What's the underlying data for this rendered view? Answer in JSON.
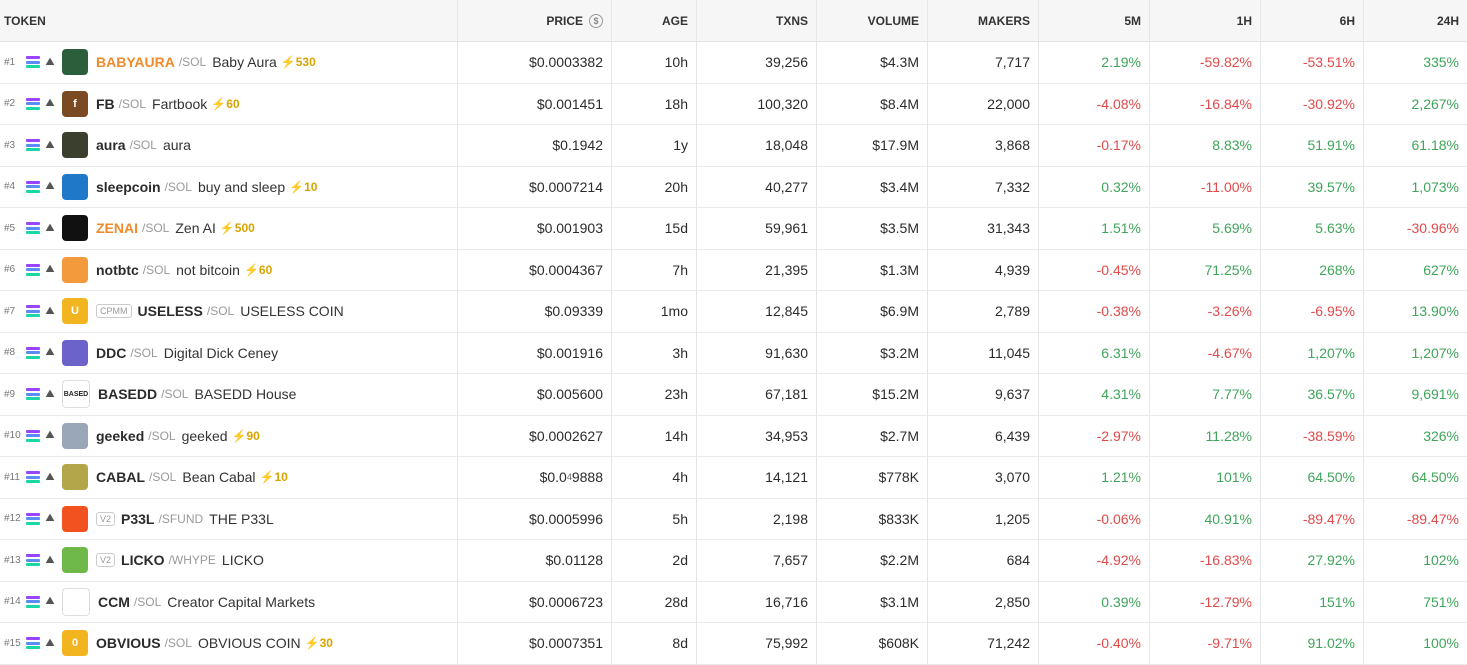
{
  "columns": {
    "token": "TOKEN",
    "price": "PRICE",
    "age": "AGE",
    "txns": "TXNS",
    "volume": "VOLUME",
    "makers": "MAKERS",
    "p5m": "5M",
    "p1h": "1H",
    "p6h": "6H",
    "p24h": "24H"
  },
  "colors": {
    "positive": "#3fa55a",
    "negative": "#e24a4a",
    "boost": "#d9a400",
    "highlight": "#f08b2c"
  },
  "rows": [
    {
      "rank": "#1",
      "symbol": "BABYAURA",
      "pair": "/SOL",
      "name": "Baby Aura",
      "boost": "⚡530",
      "tag": "",
      "highlight": true,
      "avatar": {
        "bg": "#2b5f3c",
        "glyph": ""
      },
      "price": "$0.0003382",
      "age": "10h",
      "txns": "39,256",
      "volume": "$4.3M",
      "makers": "7,717",
      "p5m": "2.19%",
      "p1h": "-59.82%",
      "p6h": "-53.51%",
      "p24h": "335%"
    },
    {
      "rank": "#2",
      "symbol": "FB",
      "pair": "/SOL",
      "name": "Fartbook",
      "boost": "⚡60",
      "tag": "",
      "highlight": false,
      "avatar": {
        "bg": "#7a4a22",
        "glyph": "f"
      },
      "price": "$0.001451",
      "age": "18h",
      "txns": "100,320",
      "volume": "$8.4M",
      "makers": "22,000",
      "p5m": "-4.08%",
      "p1h": "-16.84%",
      "p6h": "-30.92%",
      "p24h": "2,267%"
    },
    {
      "rank": "#3",
      "symbol": "aura",
      "pair": "/SOL",
      "name": "aura",
      "boost": "",
      "tag": "",
      "highlight": false,
      "avatar": {
        "bg": "#3a3f2e",
        "glyph": ""
      },
      "price": "$0.1942",
      "age": "1y",
      "txns": "18,048",
      "volume": "$17.9M",
      "makers": "3,868",
      "p5m": "-0.17%",
      "p1h": "8.83%",
      "p6h": "51.91%",
      "p24h": "61.18%"
    },
    {
      "rank": "#4",
      "symbol": "sleepcoin",
      "pair": "/SOL",
      "name": "buy and sleep",
      "boost": "⚡10",
      "tag": "",
      "highlight": false,
      "avatar": {
        "bg": "#1f79c8",
        "glyph": ""
      },
      "price": "$0.0007214",
      "age": "20h",
      "txns": "40,277",
      "volume": "$3.4M",
      "makers": "7,332",
      "p5m": "0.32%",
      "p1h": "-11.00%",
      "p6h": "39.57%",
      "p24h": "1,073%"
    },
    {
      "rank": "#5",
      "symbol": "ZENAI",
      "pair": "/SOL",
      "name": "Zen AI",
      "boost": "⚡500",
      "tag": "",
      "highlight": true,
      "avatar": {
        "bg": "#111111",
        "glyph": ""
      },
      "price": "$0.001903",
      "age": "15d",
      "txns": "59,961",
      "volume": "$3.5M",
      "makers": "31,343",
      "p5m": "1.51%",
      "p1h": "5.69%",
      "p6h": "5.63%",
      "p24h": "-30.96%"
    },
    {
      "rank": "#6",
      "symbol": "notbtc",
      "pair": "/SOL",
      "name": "not bitcoin",
      "boost": "⚡60",
      "tag": "",
      "highlight": false,
      "avatar": {
        "bg": "#f39a3c",
        "glyph": ""
      },
      "price": "$0.0004367",
      "age": "7h",
      "txns": "21,395",
      "volume": "$1.3M",
      "makers": "4,939",
      "p5m": "-0.45%",
      "p1h": "71.25%",
      "p6h": "268%",
      "p24h": "627%"
    },
    {
      "rank": "#7",
      "symbol": "USELESS",
      "pair": "/SOL",
      "name": "USELESS COIN",
      "boost": "",
      "tag": "CPMM",
      "highlight": false,
      "avatar": {
        "bg": "#f2b51f",
        "glyph": "U"
      },
      "price": "$0.09339",
      "age": "1mo",
      "txns": "12,845",
      "volume": "$6.9M",
      "makers": "2,789",
      "p5m": "-0.38%",
      "p1h": "-3.26%",
      "p6h": "-6.95%",
      "p24h": "13.90%"
    },
    {
      "rank": "#8",
      "symbol": "DDC",
      "pair": "/SOL",
      "name": "Digital Dick Ceney",
      "boost": "",
      "tag": "",
      "highlight": false,
      "avatar": {
        "bg": "#6b63c9",
        "glyph": ""
      },
      "price": "$0.001916",
      "age": "3h",
      "txns": "91,630",
      "volume": "$3.2M",
      "makers": "11,045",
      "p5m": "6.31%",
      "p1h": "-4.67%",
      "p6h": "1,207%",
      "p24h": "1,207%"
    },
    {
      "rank": "#9",
      "symbol": "BASEDD",
      "pair": "/SOL",
      "name": "BASEDD House",
      "boost": "",
      "tag": "",
      "highlight": false,
      "avatar": {
        "bg": "#ffffff",
        "glyph": "BASED"
      },
      "price": "$0.005600",
      "age": "23h",
      "txns": "67,181",
      "volume": "$15.2M",
      "makers": "9,637",
      "p5m": "4.31%",
      "p1h": "7.77%",
      "p6h": "36.57%",
      "p24h": "9,691%"
    },
    {
      "rank": "#10",
      "symbol": "geeked",
      "pair": "/SOL",
      "name": "geeked",
      "boost": "⚡90",
      "tag": "",
      "highlight": false,
      "avatar": {
        "bg": "#9aa7b8",
        "glyph": ""
      },
      "price": "$0.0002627",
      "age": "14h",
      "txns": "34,953",
      "volume": "$2.7M",
      "makers": "6,439",
      "p5m": "-2.97%",
      "p1h": "11.28%",
      "p6h": "-38.59%",
      "p24h": "326%"
    },
    {
      "rank": "#11",
      "symbol": "CABAL",
      "pair": "/SOL",
      "name": "Bean Cabal",
      "boost": "⚡10",
      "tag": "",
      "highlight": false,
      "avatar": {
        "bg": "#b3a64a",
        "glyph": ""
      },
      "price": "$0.0",
      "price_sub": "4",
      "price_tail": "9888",
      "age": "4h",
      "txns": "14,121",
      "volume": "$778K",
      "makers": "3,070",
      "p5m": "1.21%",
      "p1h": "101%",
      "p6h": "64.50%",
      "p24h": "64.50%"
    },
    {
      "rank": "#12",
      "symbol": "P33L",
      "pair": "/SFUND",
      "name": "THE P33L",
      "boost": "",
      "tag": "V2",
      "highlight": false,
      "avatar": {
        "bg": "#f2521f",
        "glyph": ""
      },
      "price": "$0.0005996",
      "age": "5h",
      "txns": "2,198",
      "volume": "$833K",
      "makers": "1,205",
      "p5m": "-0.06%",
      "p1h": "40.91%",
      "p6h": "-89.47%",
      "p24h": "-89.47%"
    },
    {
      "rank": "#13",
      "symbol": "LICKO",
      "pair": "/WHYPE",
      "name": "LICKO",
      "boost": "",
      "tag": "V2",
      "highlight": false,
      "avatar": {
        "bg": "#6fb84a",
        "glyph": ""
      },
      "price": "$0.01128",
      "age": "2d",
      "txns": "7,657",
      "volume": "$2.2M",
      "makers": "684",
      "p5m": "-4.92%",
      "p1h": "-16.83%",
      "p6h": "27.92%",
      "p24h": "102%"
    },
    {
      "rank": "#14",
      "symbol": "CCM",
      "pair": "/SOL",
      "name": "Creator Capital Markets",
      "boost": "",
      "tag": "",
      "highlight": false,
      "avatar": {
        "bg": "#ffffff",
        "glyph": ""
      },
      "price": "$0.0006723",
      "age": "28d",
      "txns": "16,716",
      "volume": "$3.1M",
      "makers": "2,850",
      "p5m": "0.39%",
      "p1h": "-12.79%",
      "p6h": "151%",
      "p24h": "751%"
    },
    {
      "rank": "#15",
      "symbol": "OBVIOUS",
      "pair": "/SOL",
      "name": "OBVIOUS COIN",
      "boost": "⚡30",
      "tag": "",
      "highlight": false,
      "avatar": {
        "bg": "#f2b51f",
        "glyph": "0"
      },
      "price": "$0.0007351",
      "age": "8d",
      "txns": "75,992",
      "volume": "$608K",
      "makers": "71,242",
      "p5m": "-0.40%",
      "p1h": "-9.71%",
      "p6h": "91.02%",
      "p24h": "100%"
    }
  ]
}
